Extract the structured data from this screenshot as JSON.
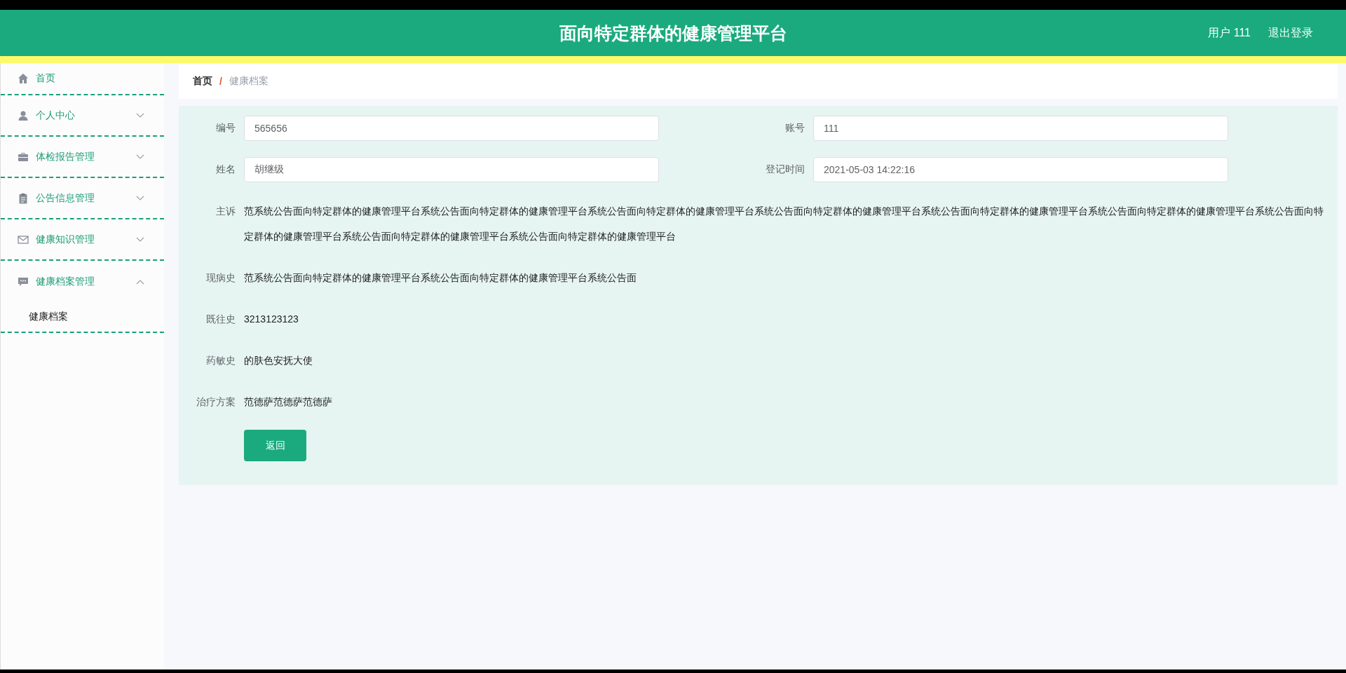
{
  "header": {
    "title": "面向特定群体的健康管理平台",
    "user": "用户 111",
    "logout": "退出登录"
  },
  "sidebar": {
    "items": [
      {
        "kind": "link",
        "label": "首页"
      },
      {
        "kind": "menu",
        "label": "个人中心",
        "expanded": false
      },
      {
        "kind": "menu",
        "label": "体检报告管理",
        "expanded": false
      },
      {
        "kind": "menu",
        "label": "公告信息管理",
        "expanded": false
      },
      {
        "kind": "menu",
        "label": "健康知识管理",
        "expanded": false
      },
      {
        "kind": "menu",
        "label": "健康档案管理",
        "expanded": true,
        "children": [
          {
            "label": "健康档案"
          }
        ]
      }
    ]
  },
  "breadcrumb": {
    "separator": "/",
    "items": [
      "首页",
      "健康档案"
    ]
  },
  "form": {
    "inputs": [
      {
        "label": "编号",
        "value": "565656"
      },
      {
        "label": "账号",
        "value": "111"
      },
      {
        "label": "姓名",
        "value": "胡继级"
      },
      {
        "label": "登记时间",
        "value": "2021-05-03 14:22:16"
      }
    ],
    "texts": [
      {
        "label": "主诉",
        "value": "范系统公告面向特定群体的健康管理平台系统公告面向特定群体的健康管理平台系统公告面向特定群体的健康管理平台系统公告面向特定群体的健康管理平台系统公告面向特定群体的健康管理平台系统公告面向特定群体的健康管理平台系统公告面向特定群体的健康管理平台系统公告面向特定群体的健康管理平台系统公告面向特定群体的健康管理平台"
      },
      {
        "label": "现病史",
        "value": "范系统公告面向特定群体的健康管理平台系统公告面向特定群体的健康管理平台系统公告面"
      },
      {
        "label": "既往史",
        "value": "3213123123"
      },
      {
        "label": "药敏史",
        "value": "的肤色安抚大使"
      },
      {
        "label": "治疗方案",
        "value": "范德萨范德萨范德萨"
      }
    ],
    "button": "返回"
  }
}
